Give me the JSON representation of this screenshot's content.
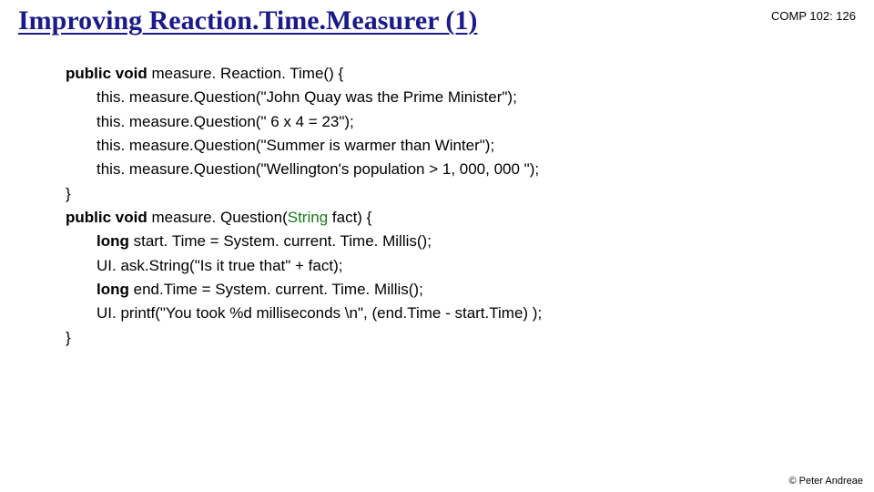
{
  "header": {
    "title": "Improving Reaction.Time.Measurer (1)",
    "course": "COMP 102: 126"
  },
  "code": {
    "l1a": "public void",
    "l1b": " measure. Reaction. Time() {",
    "l2": "this. measure.Question(\"John Quay was the Prime Minister\");",
    "l3": "this. measure.Question(\" 6  x 4 = 23\");",
    "l4": "this. measure.Question(\"Summer is warmer than Winter\");",
    "l5": "this. measure.Question(\"Wellington's population > 1, 000, 000 \");",
    "l6": "}",
    "l7a": "public void",
    "l7b": " measure. Question(",
    "l7c": "String",
    "l7d": " fact) {",
    "l8a": "long",
    "l8b": " start. Time = System. current. Time. Millis();",
    "l9": "UI. ask.String(\"Is it true that\" + fact);",
    "l10a": "long",
    "l10b": " end.Time = System. current. Time. Millis();",
    "l11": "UI. printf(\"You took %d milliseconds \\n\",  (end.Time - start.Time) );",
    "l12": "}"
  },
  "footer": {
    "copyright": "© Peter Andreae"
  }
}
